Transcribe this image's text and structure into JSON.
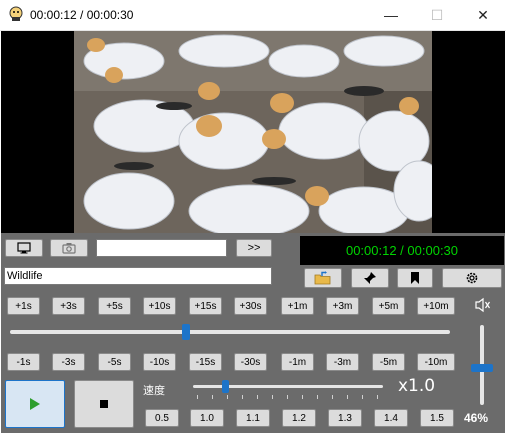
{
  "window": {
    "title": "00:00:12 / 00:00:30",
    "minimize_glyph": "—",
    "maximize_glyph": "☐",
    "close_glyph": "✕"
  },
  "toolbar": {
    "next_label": ">>",
    "name_input_value": "",
    "time_display": "00:00:12 / 00:00:30",
    "title_input_value": "Wildlife"
  },
  "jump_forward": [
    "+1s",
    "+3s",
    "+5s",
    "+10s",
    "+15s",
    "+30s",
    "+1m",
    "+3m",
    "+5m",
    "+10m"
  ],
  "jump_back": [
    "-1s",
    "-3s",
    "-5s",
    "-10s",
    "-15s",
    "-30s",
    "-1m",
    "-3m",
    "-5m",
    "-10m"
  ],
  "seek": {
    "position_fraction": 0.4
  },
  "speed": {
    "label": "速度",
    "value_text": "x1.0",
    "presets": [
      "0.5",
      "1.0",
      "1.1",
      "1.2",
      "1.3",
      "1.4",
      "1.5"
    ],
    "slider_fraction": 0.17
  },
  "volume": {
    "percent_text": "46%",
    "level_fraction": 0.46
  },
  "icons": {
    "screen": "monitor-icon",
    "snapshot": "camera-icon",
    "open_folder": "folder-icon",
    "pin": "pin-icon",
    "bookmark": "bookmark-icon",
    "settings": "gear-icon",
    "speaker": "speaker-icon",
    "play": "play-icon",
    "stop": "stop-icon"
  },
  "colors": {
    "panel_bg": "#6b6b6b",
    "accent": "#1d74c9",
    "time_text": "#00d400",
    "play_icon": "#2e9e2e"
  }
}
